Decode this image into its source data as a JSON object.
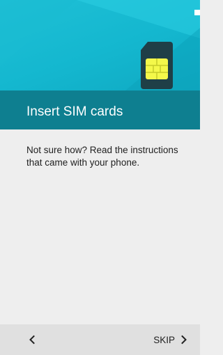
{
  "header": {
    "title": "Insert SIM cards"
  },
  "content": {
    "instructions": "Not sure how? Read the instructions that came with your phone."
  },
  "navigation": {
    "skip_label": "SKIP"
  },
  "icons": {
    "hero": "sim-card-icon",
    "back": "chevron-left-icon",
    "next": "chevron-right-icon"
  },
  "colors": {
    "accent": "#14b7cf",
    "title_bar": "#0e7f90",
    "background": "#eeeeee",
    "nav_bar": "#e0e0e0"
  }
}
